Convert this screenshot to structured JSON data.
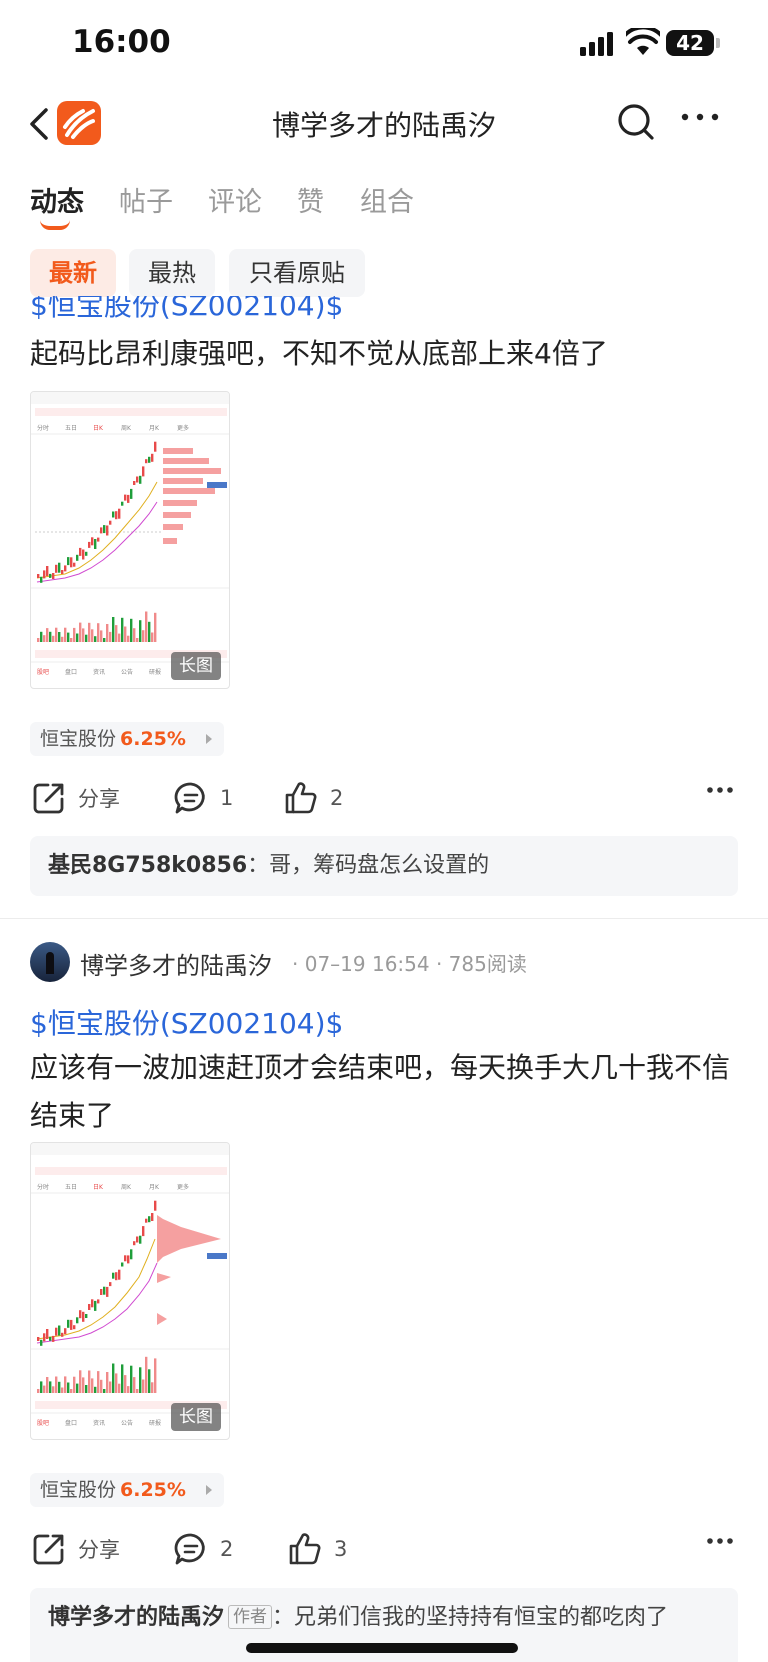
{
  "status": {
    "time": "16:00",
    "battery": "42"
  },
  "header": {
    "title": "博学多才的陆禹汐"
  },
  "tabs": [
    "动态",
    "帖子",
    "评论",
    "赞",
    "组合"
  ],
  "filters": [
    "最新",
    "最热",
    "只看原贴"
  ],
  "posts": [
    {
      "stock_tag": "$恒宝股份(SZ002104)$",
      "text": "起码比昂利康强吧，不知不觉从底部上来4倍了",
      "image_badge": "长图",
      "stock": {
        "name": "恒宝股份",
        "change": "6.25%"
      },
      "actions": {
        "share": "分享",
        "comments": "1",
        "likes": "2"
      },
      "comment": {
        "author": "基民8G758k0856",
        "text": "：哥，筹码盘怎么设置的"
      }
    },
    {
      "author": "博学多才的陆禹汐",
      "meta": "· 07–19 16:54 · 785阅读",
      "stock_tag": "$恒宝股份(SZ002104)$",
      "text": "应该有一波加速赶顶才会结束吧，每天换手大几十我不信结束了",
      "image_badge": "长图",
      "stock": {
        "name": "恒宝股份",
        "change": "6.25%"
      },
      "actions": {
        "share": "分享",
        "comments": "2",
        "likes": "3"
      },
      "comment": {
        "author": "博学多才的陆禹汐",
        "tag": "作者",
        "text": "：兄弟们信我的坚持持有恒宝的都吃肉了"
      }
    }
  ],
  "colors": {
    "accent": "#f25a1c",
    "link": "#2a66d9",
    "rise": "#e84a4a",
    "fall": "#1f9e3a"
  }
}
